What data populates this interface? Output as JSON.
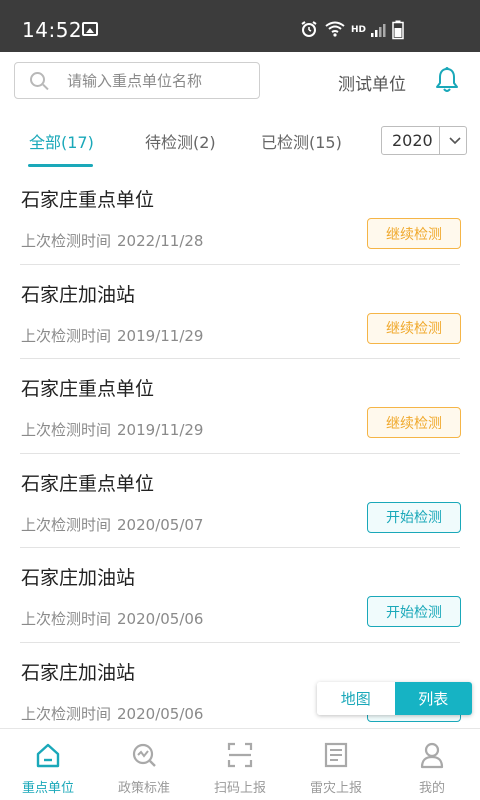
{
  "status_bar": {
    "time": "14:52",
    "network": "HD"
  },
  "header": {
    "search_placeholder": "请输入重点单位名称",
    "unit_name": "测试单位"
  },
  "tabs": [
    {
      "label": "全部(17)",
      "active": true
    },
    {
      "label": "待检测(2)",
      "active": false
    },
    {
      "label": "已检测(15)",
      "active": false
    }
  ],
  "year_select": {
    "value": "2020"
  },
  "list": {
    "items": [
      {
        "title": "石家庄重点单位",
        "label": "上次检测时间",
        "date": "2022/11/28",
        "action": "继续检测",
        "action_type": "continue"
      },
      {
        "title": "石家庄加油站",
        "label": "上次检测时间",
        "date": "2019/11/29",
        "action": "继续检测",
        "action_type": "continue"
      },
      {
        "title": "石家庄重点单位",
        "label": "上次检测时间",
        "date": "2019/11/29",
        "action": "继续检测",
        "action_type": "continue"
      },
      {
        "title": "石家庄重点单位",
        "label": "上次检测时间",
        "date": "2020/05/07",
        "action": "开始检测",
        "action_type": "start"
      },
      {
        "title": "石家庄加油站",
        "label": "上次检测时间",
        "date": "2020/05/06",
        "action": "开始检测",
        "action_type": "start"
      },
      {
        "title": "石家庄加油站",
        "label": "上次检测时间",
        "date": "2020/05/06",
        "action": "",
        "action_type": "start"
      }
    ]
  },
  "view_toggle": {
    "map_label": "地图",
    "list_label": "列表",
    "selected": "list"
  },
  "bottom_nav": [
    {
      "label": "重点单位",
      "icon": "home-icon",
      "active": true
    },
    {
      "label": "政策标准",
      "icon": "policy-icon",
      "active": false
    },
    {
      "label": "扫码上报",
      "icon": "scan-icon",
      "active": false
    },
    {
      "label": "雷灾上报",
      "icon": "report-icon",
      "active": false
    },
    {
      "label": "我的",
      "icon": "user-icon",
      "active": false
    }
  ],
  "colors": {
    "accent": "#1aa8b9",
    "warning": "#f0a92d",
    "statusbar": "#3c3c3c"
  }
}
